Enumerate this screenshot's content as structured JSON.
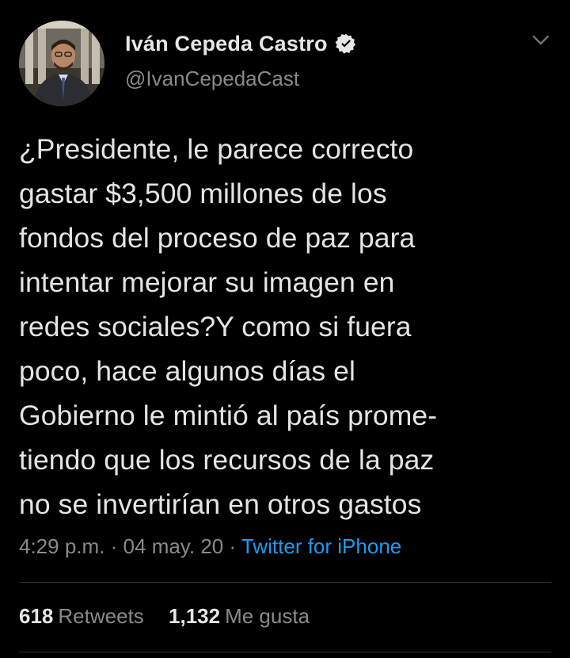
{
  "author": {
    "display_name": "Iván Cepeda Castro",
    "handle": "@IvanCepedaCast",
    "verified": true,
    "avatar_icon": "profile-photo"
  },
  "tweet": {
    "text": "¿Presidente, le parece correcto\ngastar $3,500 millones de los\nfondos del proceso de paz para\nintentar mejorar su imagen en\nredes sociales?Y como si fuera\npoco, hace algunos días el\nGobierno le mintió al país prome-\ntiendo que los recursos de la paz\nno se invertirían en otros gastos"
  },
  "meta": {
    "time": "4:29 p.m.",
    "separator": "·",
    "date": "04 may. 20",
    "source": "Twitter for iPhone"
  },
  "stats": {
    "retweets_count": "618",
    "retweets_label": "Retweets",
    "likes_count": "1,132",
    "likes_label": "Me gusta"
  },
  "colors": {
    "background": "#000000",
    "link": "#1d9bf0",
    "muted": "#8a8a8a",
    "text": "#e4e4e4"
  }
}
